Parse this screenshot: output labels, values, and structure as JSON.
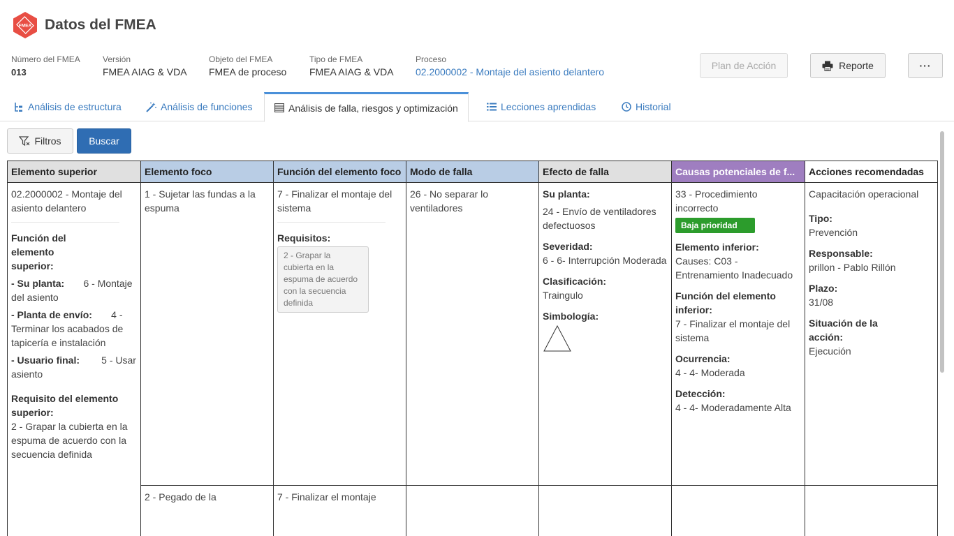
{
  "app": {
    "logo_text": "FMEA",
    "title": "Datos del FMEA"
  },
  "meta": [
    {
      "label": "Número del FMEA",
      "value": "013"
    },
    {
      "label": "Versión",
      "value": "FMEA AIAG & VDA"
    },
    {
      "label": "Objeto del FMEA",
      "value": "FMEA de proceso"
    },
    {
      "label": "Tipo de FMEA",
      "value": "FMEA AIAG & VDA"
    },
    {
      "label": "Proceso",
      "value": "02.2000002 - Montaje del asiento delantero"
    }
  ],
  "actions": {
    "plan": "Plan de Acción",
    "report": "Reporte",
    "more": "···"
  },
  "tabs": [
    {
      "label": "Análisis de estructura",
      "icon": "structure-icon"
    },
    {
      "label": "Análisis de funciones",
      "icon": "magic-wand-icon"
    },
    {
      "label": "Análisis de falla, riesgos y optimización",
      "icon": "table-icon"
    },
    {
      "label": "Lecciones aprendidas",
      "icon": "list-icon"
    },
    {
      "label": "Historial",
      "icon": "clock-icon"
    }
  ],
  "toolbar": {
    "filters": "Filtros",
    "search": "Buscar"
  },
  "colors": {
    "accent": "#2f6db3",
    "link": "#3a7bbf",
    "purple_header": "#9f7ec0",
    "blue_header": "#b9cde5",
    "badge_green": "#2c9c2c"
  },
  "table": {
    "headers": [
      "Elemento superior",
      "Elemento foco",
      "Función del elemento foco",
      "Modo de falla",
      "Efecto de falla",
      "Causas potenciales de f...",
      "Acciones recomendadas"
    ],
    "superior": {
      "name": "02.2000002 - Montaje del asiento delantero",
      "function_label": "Función del elemento superior:",
      "planta_label": "- Su planta:",
      "planta_value": "6 - Montaje del asiento",
      "envio_label": "- Planta de envío:",
      "envio_value": "4 - Terminar los acabados de tapicería e instalación",
      "usuario_label": "- Usuario final:",
      "usuario_value": "5 - Usar asiento",
      "requisito_label": "Requisito del elemento superior:",
      "requisito_value": "2 - Grapar la cubierta en la espuma de acuerdo con la secuencia definida"
    },
    "foco": {
      "row1": "1 - Sujetar las fundas a la espuma",
      "row2": "2 - Pegado de la"
    },
    "funcion": {
      "row1": "7 - Finalizar el montaje del sistema",
      "req_label": "Requisitos:",
      "req_value": "2 - Grapar la cubierta en la espuma de acuerdo con la secuencia definida",
      "row2": "7 - Finalizar el montaje"
    },
    "modo": {
      "row1": "26 - No separar lo ventiladores"
    },
    "efecto": {
      "planta_label": "Su planta:",
      "planta_value": "24 - Envío de ventiladores defectuosos",
      "severidad_label": "Severidad:",
      "severidad_value": "6 - 6- Interrupción Moderada",
      "clasif_label": "Clasificación:",
      "clasif_value": "Traingulo",
      "simb_label": "Simbología:",
      "simb_icon": "triangle-icon"
    },
    "causas": {
      "name": "33 - Procedimiento incorrecto",
      "badge": "Baja prioridad",
      "inferior_label": "Elemento inferior:",
      "inferior_value": "Causes: C03 - Entrenamiento Inadecuado",
      "func_inf_label": "Función del elemento inferior:",
      "func_inf_value": "7 - Finalizar el montaje del sistema",
      "ocurrencia_label": "Ocurrencia:",
      "ocurrencia_value": "4 - 4- Moderada",
      "deteccion_label": "Detección:",
      "deteccion_value": "4 - 4- Moderadamente Alta"
    },
    "acciones": {
      "name": "Capacitación operacional",
      "tipo_label": "Tipo:",
      "tipo_value": "Prevención",
      "resp_label": "Responsable:",
      "resp_value": "prillon - Pablo Rillón",
      "plazo_label": "Plazo:",
      "plazo_value": "31/08",
      "situacion_label": "Situación de la acción:",
      "situacion_value": "Ejecución"
    }
  }
}
